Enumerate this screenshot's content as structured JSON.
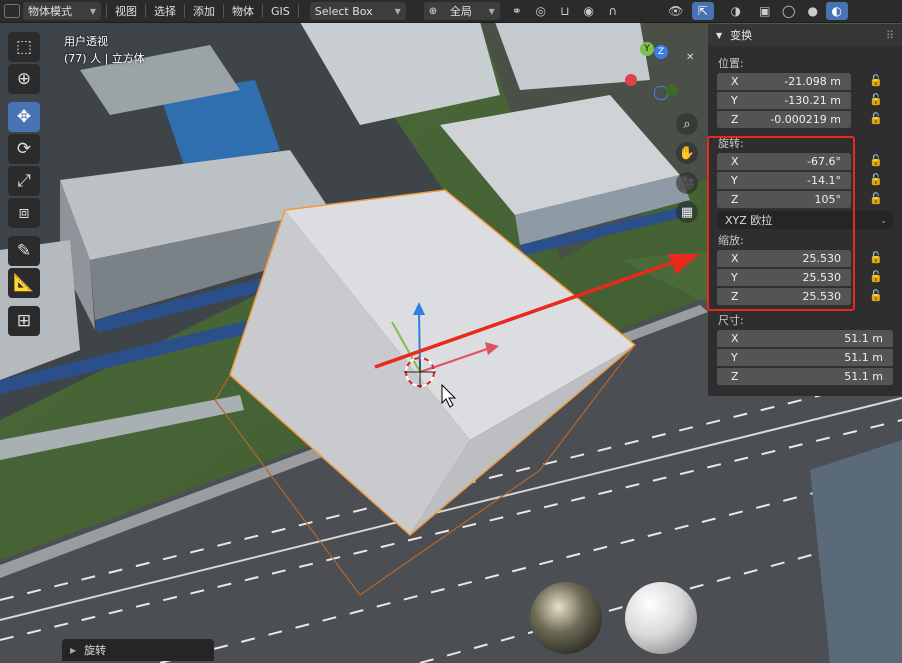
{
  "header": {
    "mode": "物体模式",
    "menus": [
      "视图",
      "选择",
      "添加",
      "物体",
      "GIS"
    ],
    "select_mode": "Select Box",
    "transform_orientation": "全局"
  },
  "viewport": {
    "view_name": "用户透视",
    "collection_info": "(77) 人 | 立方体",
    "gizmo_axes": [
      "X",
      "Y",
      "Z"
    ]
  },
  "sidebar": {
    "panel_title": "变换",
    "location": {
      "label": "位置:",
      "x": {
        "axis": "X",
        "value": "-21.098 m"
      },
      "y": {
        "axis": "Y",
        "value": "-130.21 m"
      },
      "z": {
        "axis": "Z",
        "value": "-0.000219 m"
      }
    },
    "rotation": {
      "label": "旋转:",
      "x": {
        "axis": "X",
        "value": "-67.6°"
      },
      "y": {
        "axis": "Y",
        "value": "-14.1°"
      },
      "z": {
        "axis": "Z",
        "value": "105°"
      },
      "mode": "XYZ 欧拉"
    },
    "scale": {
      "label": "缩放:",
      "x": {
        "axis": "X",
        "value": "25.530"
      },
      "y": {
        "axis": "Y",
        "value": "25.530"
      },
      "z": {
        "axis": "Z",
        "value": "25.530"
      }
    },
    "dimensions": {
      "label": "尺寸:",
      "x": {
        "axis": "X",
        "value": "51.1 m"
      },
      "y": {
        "axis": "Y",
        "value": "51.1 m"
      },
      "z": {
        "axis": "Z",
        "value": "51.1 m"
      }
    }
  },
  "redo_panel": {
    "label": "旋转"
  },
  "colors": {
    "highlight": "#e8291c",
    "accent": "#4772b3",
    "selection_outline": "#f09a3c"
  }
}
